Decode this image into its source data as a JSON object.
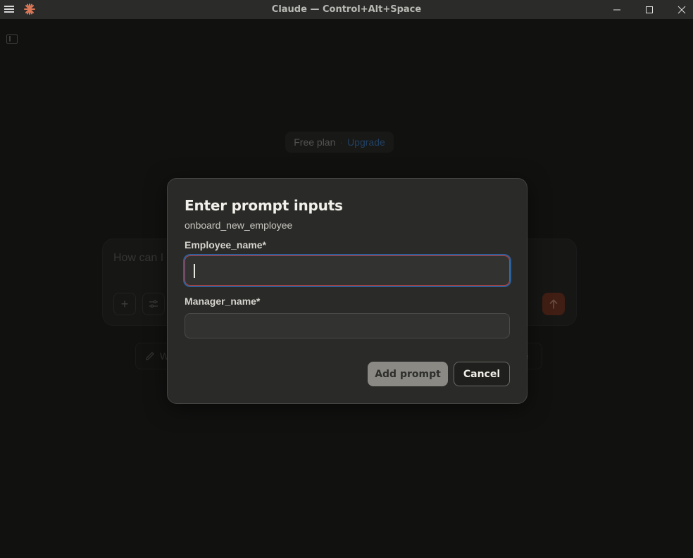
{
  "window": {
    "title": "Claude — Control+Alt+Space",
    "menu_icon": "hamburger-menu-icon",
    "logo_icon": "claude-asterisk-logo",
    "controls": [
      "minimize-icon",
      "maximize-icon",
      "close-icon"
    ]
  },
  "background": {
    "plan": {
      "label": "Free plan",
      "separator": "·",
      "upgrade": "Upgrade"
    },
    "composer": {
      "placeholder": "How can I"
    },
    "suggestion_left": "W",
    "suggestion_right": "e"
  },
  "dialog": {
    "title": "Enter prompt inputs",
    "subtitle": "onboard_new_employee",
    "fields": [
      {
        "label": "Employee_name*",
        "value": ""
      },
      {
        "label": "Manager_name*",
        "value": ""
      }
    ],
    "add_button": "Add prompt",
    "cancel_button": "Cancel"
  },
  "colors": {
    "accent": "#d97757",
    "upgrade_link": "#3a6ea8",
    "focus_ring": "#2d5f9a",
    "error_border": "#c0392b"
  }
}
